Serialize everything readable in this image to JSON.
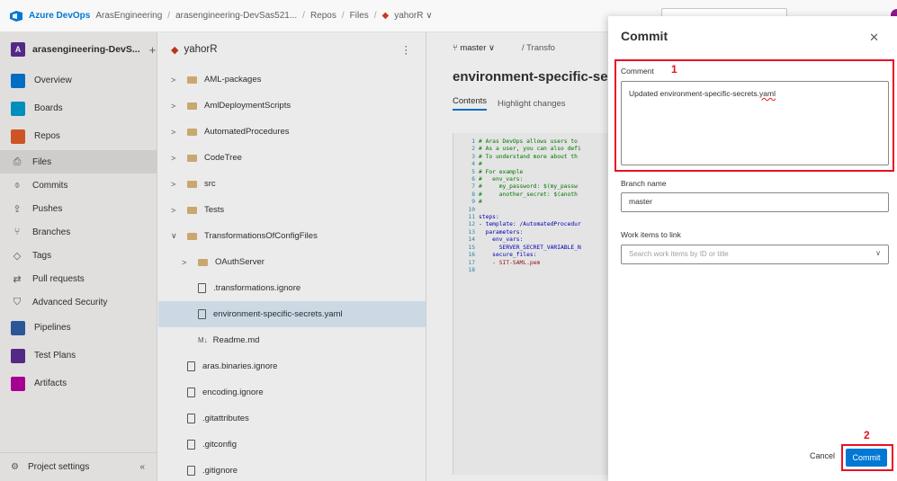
{
  "topbar": {
    "brand": "Azure DevOps",
    "crumbs": [
      "ArasEngineering",
      "arasengineering-DevSas521...",
      "Repos",
      "Files",
      "yahorR ∨"
    ]
  },
  "sidebar": {
    "org_badge": "A",
    "org_name": "arasengineering-DevS...",
    "items": [
      {
        "label": "Overview",
        "color": "#0078d4"
      },
      {
        "label": "Boards",
        "color": "#009ccc"
      },
      {
        "label": "Repos",
        "color": "#e05c28"
      },
      {
        "label": "Files",
        "icon": "⎙"
      },
      {
        "label": "Commits",
        "icon": "⌽"
      },
      {
        "label": "Pushes",
        "icon": "⇪"
      },
      {
        "label": "Branches",
        "icon": "⑂"
      },
      {
        "label": "Tags",
        "icon": "◇"
      },
      {
        "label": "Pull requests",
        "icon": "⇄"
      },
      {
        "label": "Advanced Security",
        "icon": "⛉"
      },
      {
        "label": "Pipelines",
        "color": "#2f5fa7"
      },
      {
        "label": "Test Plans",
        "color": "#5c2d91"
      },
      {
        "label": "Artifacts",
        "color": "#b4009e"
      }
    ],
    "settings": "Project settings"
  },
  "tree": {
    "repo": "yahorR",
    "rows": [
      {
        "label": "AML-packages",
        "type": "folder",
        "caret": ">"
      },
      {
        "label": "AmlDeploymentScripts",
        "type": "folder",
        "caret": ">"
      },
      {
        "label": "AutomatedProcedures",
        "type": "folder",
        "caret": ">"
      },
      {
        "label": "CodeTree",
        "type": "folder",
        "caret": ">"
      },
      {
        "label": "src",
        "type": "folder",
        "caret": ">"
      },
      {
        "label": "Tests",
        "type": "folder",
        "caret": ">"
      },
      {
        "label": "TransformationsOfConfigFiles",
        "type": "folder",
        "caret": "∨"
      },
      {
        "label": "OAuthServer",
        "type": "folder",
        "caret": ">"
      },
      {
        "label": ".transformations.ignore",
        "type": "file",
        "caret": ""
      },
      {
        "label": "environment-specific-secrets.yaml",
        "type": "file",
        "caret": ""
      },
      {
        "label": "Readme.md",
        "type": "md",
        "caret": ""
      },
      {
        "label": "aras.binaries.ignore",
        "type": "file",
        "caret": ""
      },
      {
        "label": "encoding.ignore",
        "type": "file",
        "caret": ""
      },
      {
        "label": ".gitattributes",
        "type": "file",
        "caret": ""
      },
      {
        "label": ".gitconfig",
        "type": "file",
        "caret": ""
      },
      {
        "label": ".gitignore",
        "type": "file",
        "caret": ""
      }
    ]
  },
  "content": {
    "branch": "master",
    "path": "/ Transfo",
    "title": "environment-specific-secret",
    "tabs": [
      "Contents",
      "Highlight changes"
    ],
    "code": [
      {
        "n": "1",
        "t": "# Aras DevOps allows users to",
        "cls": "c"
      },
      {
        "n": "2",
        "t": "# As a user, you can also defi",
        "cls": "c"
      },
      {
        "n": "3",
        "t": "# To understand more about th",
        "cls": "c"
      },
      {
        "n": "4",
        "t": "#",
        "cls": "c"
      },
      {
        "n": "5",
        "t": "# For example",
        "cls": "c"
      },
      {
        "n": "6",
        "t": "#   env_vars:",
        "cls": "c"
      },
      {
        "n": "7",
        "t": "#     my_password: $(my_passw",
        "cls": "c"
      },
      {
        "n": "8",
        "t": "#     another_secret: $(anoth",
        "cls": "c"
      },
      {
        "n": "9",
        "t": "#",
        "cls": "c"
      },
      {
        "n": "10",
        "t": "",
        "cls": ""
      },
      {
        "n": "11",
        "t": "steps:",
        "cls": "k"
      },
      {
        "n": "12",
        "t": "- template: /AutomatedProcedur",
        "cls": "k"
      },
      {
        "n": "13",
        "t": "  parameters:",
        "cls": "k"
      },
      {
        "n": "14",
        "t": "    env_vars:",
        "cls": "k"
      },
      {
        "n": "15",
        "t": "      SERVER_SECRET_VARIABLE_N",
        "cls": "k"
      },
      {
        "n": "16",
        "t": "    secure_files:",
        "cls": "k"
      },
      {
        "n": "17",
        "t": "    - SIT-SAML.pem",
        "cls": "s"
      },
      {
        "n": "18",
        "t": "",
        "cls": ""
      }
    ]
  },
  "modal": {
    "title": "Commit",
    "comment_label": "Comment",
    "comment_marker": "1",
    "comment_prefix": "Updated environment-specific-secrets.",
    "comment_suffix": "yaml",
    "branch_label": "Branch name",
    "branch_value": "master",
    "work_items_label": "Work items to link",
    "work_items_placeholder": "Search work items by ID or title",
    "cancel": "Cancel",
    "commit": "Commit",
    "commit_marker": "2",
    "highlight_color": "#e81123"
  }
}
